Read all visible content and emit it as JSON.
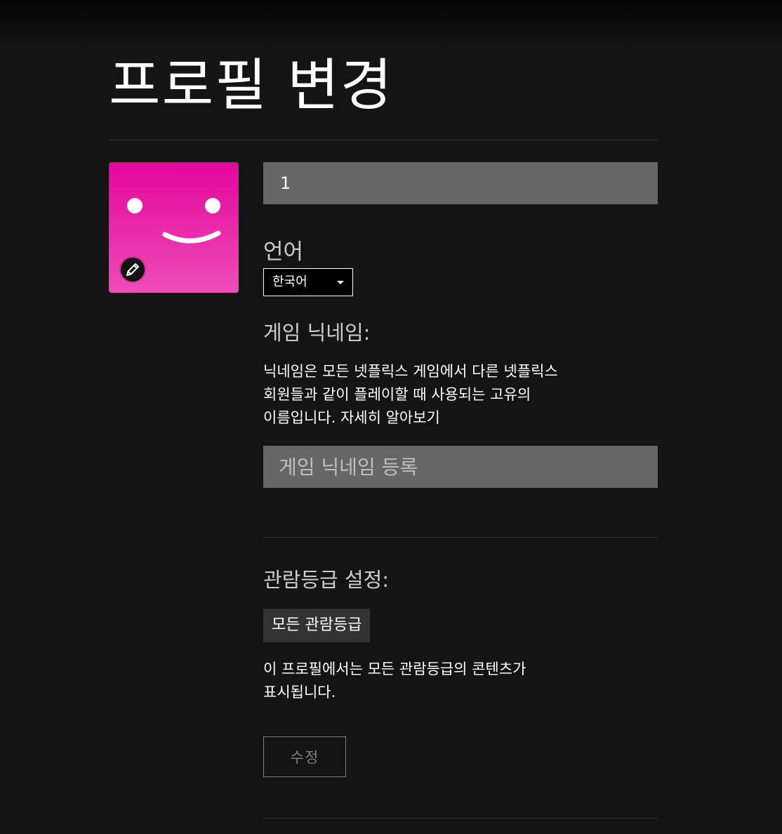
{
  "page": {
    "title": "프로필 변경"
  },
  "profile": {
    "name_value": "1",
    "avatar_icon": "smiley-face-icon",
    "edit_avatar_icon": "pencil-icon",
    "avatar_colors": [
      "#e3069c",
      "#ee4db7"
    ]
  },
  "language": {
    "label": "언어",
    "selected": "한국어"
  },
  "game_nickname": {
    "heading": "게임 닉네임:",
    "description_lines": [
      "닉네임은 모든 넷플릭스 게임에서 다른 넷플릭스",
      "회원들과 같이 플레이할 때 사용되는 고유의",
      "이름입니다. 자세히 알아보기"
    ],
    "placeholder": "게임 닉네임 등록"
  },
  "maturity": {
    "heading": "관람등급 설정:",
    "badge": "모든 관람등급",
    "description_lines": [
      "이 프로필에서는 모든 관람등급의 콘텐츠가",
      "표시됩니다."
    ],
    "edit_label": "수정"
  }
}
